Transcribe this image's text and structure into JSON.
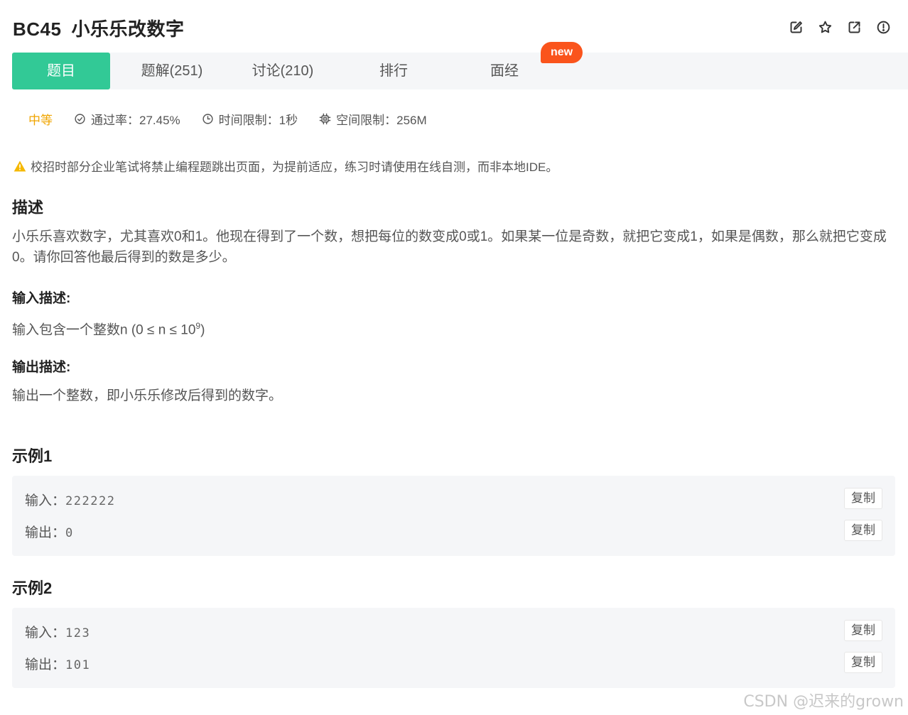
{
  "header": {
    "code": "BC45",
    "title": "小乐乐改数字",
    "icons": [
      "edit-icon",
      "star-icon",
      "external-link-icon",
      "alert-circle-icon"
    ]
  },
  "tabs": [
    {
      "label": "题目",
      "active": true
    },
    {
      "label": "题解(251)"
    },
    {
      "label": "讨论(210)"
    },
    {
      "label": "排行"
    },
    {
      "label": "面经",
      "badge": "new"
    }
  ],
  "meta": {
    "difficulty": "中等",
    "pass_rate": "通过率：27.45%",
    "time_limit": "时间限制：1秒",
    "memory_limit": "空间限制：256M"
  },
  "warning": "校招时部分企业笔试将禁止编程题跳出页面，为提前适应，练习时请使用在线自测，而非本地IDE。",
  "description": {
    "heading": "描述",
    "text": "小乐乐喜欢数字，尤其喜欢0和1。他现在得到了一个数，想把每位的数变成0或1。如果某一位是奇数，就把它变成1，如果是偶数，那么就把它变成0。请你回答他最后得到的数是多少。"
  },
  "input_desc": {
    "heading": "输入描述:",
    "text_prefix": "输入包含一个整数n (0 ≤ n ≤ 10",
    "text_sup": "9",
    "text_suffix": ")"
  },
  "output_desc": {
    "heading": "输出描述:",
    "text": "输出一个整数，即小乐乐修改后得到的数字。"
  },
  "examples": [
    {
      "heading": "示例1",
      "input_label": "输入：",
      "input": "222222",
      "output_label": "输出：",
      "output": "0",
      "copy_label": "复制"
    },
    {
      "heading": "示例2",
      "input_label": "输入：",
      "input": "123",
      "output_label": "输出：",
      "output": "101",
      "copy_label": "复制"
    }
  ],
  "watermark": "CSDN @迟来的grown",
  "colors": {
    "accent": "#32c996",
    "badge": "#fa541c",
    "difficulty": "#f0a500",
    "warning": "#f5b800"
  }
}
